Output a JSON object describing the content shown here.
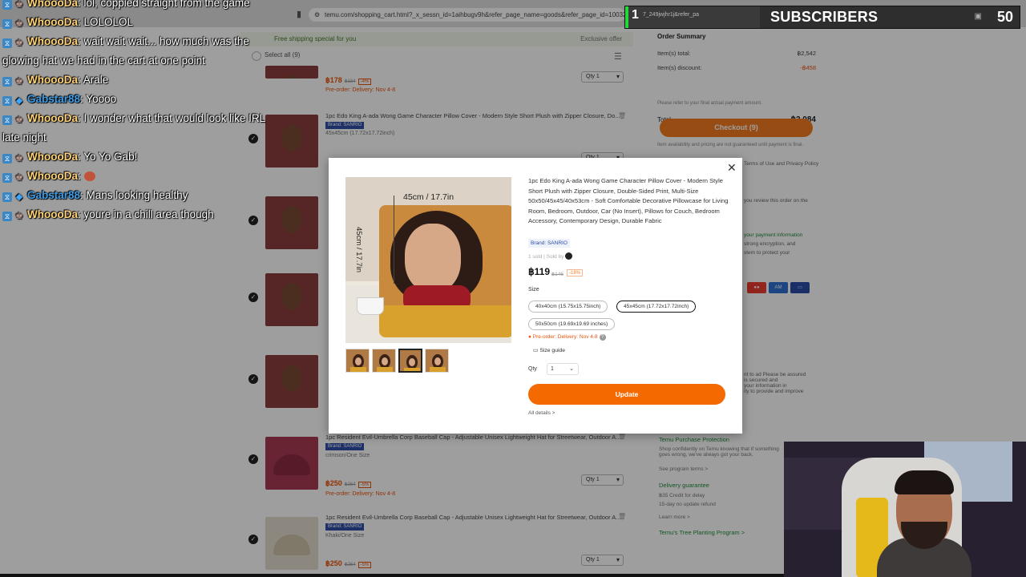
{
  "browser": {
    "url": "temu.com/shopping_cart.html?_x_sessn_id=1aihbugv9h&refer_page_name=goods&refer_page_id=10032_1761707"
  },
  "cart": {
    "shipping_banner": "Free shipping special for you",
    "exclusive": "Exclusive offer",
    "select_all": "Select all (9)",
    "items": [
      {
        "title": "",
        "brand": "",
        "variant": "",
        "price": "฿178",
        "old": "฿184",
        "off": "-4%",
        "preorder": "Pre-order: Delivery: Nov 4-8",
        "qty": "Qty 1"
      },
      {
        "title": "1pc Edo King A-ada Wong Game Character Pillow Cover - Modern Style Short Plush with Zipper Closure, Do...",
        "brand": "Brand: SANRIO",
        "variant": "45x45cm (17.72x17.72inch)",
        "price": "",
        "old": "",
        "off": "",
        "preorder": "",
        "qty": "Qty 1"
      },
      {
        "title": "1pc Resident Evil-Umbrella Corp Baseball Cap - Adjustable Unisex Lightweight Hat for Streetwear, Outdoor A...",
        "brand": "Brand: SANRIO",
        "variant": "crimson/One Size",
        "price": "฿250",
        "old": "฿264",
        "off": "-5%",
        "preorder": "Pre-order: Delivery: Nov 4-8",
        "qty": "Qty 1"
      },
      {
        "title": "1pc Resident Evil-Umbrella Corp Baseball Cap - Adjustable Unisex Lightweight Hat for Streetwear, Outdoor A...",
        "brand": "Brand: SANRIO",
        "variant": "Khaki/One Size",
        "price": "฿250",
        "old": "฿264",
        "off": "-5%",
        "preorder": "",
        "qty": "Qty 1"
      }
    ]
  },
  "summary": {
    "heading": "Order Summary",
    "items_total_label": "Item(s) total:",
    "items_total": "฿2,542",
    "items_discount_label": "Item(s) discount:",
    "items_discount": "-฿458",
    "total_label": "Total",
    "total": "฿2,084",
    "refer_note": "Please refer to your final actual payment amount.",
    "checkout": "Checkout (9)",
    "avail_note": "Item availability and pricing are not guaranteed until payment is final.",
    "terms": "Terms of Use and Privacy Policy",
    "review_note": "you review this order on the",
    "payment_info": "your payment information",
    "encryption": "strong encryption, and",
    "protect": "stem to protect your",
    "protection_title": "Temu Purchase Protection",
    "protection_desc": "Shop confidently on Temu knowing that if something goes wrong, we've always got your back.",
    "see_program": "See program terms >",
    "delivery_title": "Delivery guarantee",
    "delivery_1": "฿35 Credit for delay",
    "delivery_2": "15-day no update refund",
    "delivery_3": "Return if item da",
    "delivery_4": "30-day no delivery",
    "learn_more": "Learn more >",
    "tree": "Temu's Tree Planting Program >",
    "secure_1": "nt to ad Please be assured",
    "secure_2": "is secured and",
    "secure_3": "your information in",
    "secure_4": "ity to provide and improve"
  },
  "chat": [
    {
      "user": "WhoooDa",
      "text": ": lol, coppied straight from the game",
      "blue": false,
      "emote": false
    },
    {
      "user": "WhoooDa",
      "text": ": LOLOLOL",
      "blue": false,
      "emote": false
    },
    {
      "user": "WhoooDa",
      "text": ": wait wait wait... how much was the glowing hat we had in the cart at one point",
      "blue": false,
      "emote": false
    },
    {
      "user": "WhoooDa",
      "text": ": Arale",
      "blue": false,
      "emote": false
    },
    {
      "user": "Gabstar88",
      "text": ": Yoooo",
      "blue": true,
      "emote": false
    },
    {
      "user": "WhoooDa",
      "text": ": I wonder what that would look like IRL late night",
      "blue": false,
      "emote": false
    },
    {
      "user": "WhoooDa",
      "text": ": Yo Yo Gab!",
      "blue": false,
      "emote": false
    },
    {
      "user": "WhoooDa",
      "text": ":",
      "blue": false,
      "emote": true
    },
    {
      "user": "Gabstar88",
      "text": ": Mans looking healthy",
      "blue": true,
      "emote": false
    },
    {
      "user": "WhoooDa",
      "text": ": youre in a chill area though",
      "blue": false,
      "emote": false
    }
  ],
  "subscribers": {
    "mini_num": "1",
    "mini_user": "7_249jwjhr1j&refer_pa",
    "label": "SUBSCRIBERS",
    "count": "50"
  },
  "modal": {
    "title": "1pc Edo King A-ada Wong Game Character Pillow Cover - Modern Style Short Plush with Zipper Closure, Double-Sided Print, Multi-Size 50x50/45x45/40x53cm - Soft Comfortable Decorative Pillowcase for Living Room, Bedroom, Outdoor, Car (No Insert), Pillows for Couch, Bedroom Accessory, Contemporary Design, Durable Fabric",
    "brand": "Brand: SANRIO",
    "sold": "1 sold | Sold by",
    "price": "฿119",
    "old_price": "฿146",
    "discount": "-18%",
    "size_label": "Size",
    "sizes": [
      "40x40cm (15.75x15.75inch)",
      "45x45cm (17.72x17.72inch)",
      "50x50cm (19.69x19.69 inches)"
    ],
    "selected_size": "45x45cm (17.72x17.72inch)",
    "preorder": "Pre-order: Delivery: Nov 4-8",
    "size_guide": "Size guide",
    "qty_label": "Qty",
    "qty": "1",
    "update": "Update",
    "all_details": "All details >",
    "image_dim_w": "45cm / 17.7in",
    "image_dim_h": "45cm / 17.7in"
  },
  "colors": {
    "accent": "#f56a00",
    "brand_blue": "#2f4ea7",
    "sub_green": "#22d83a"
  }
}
